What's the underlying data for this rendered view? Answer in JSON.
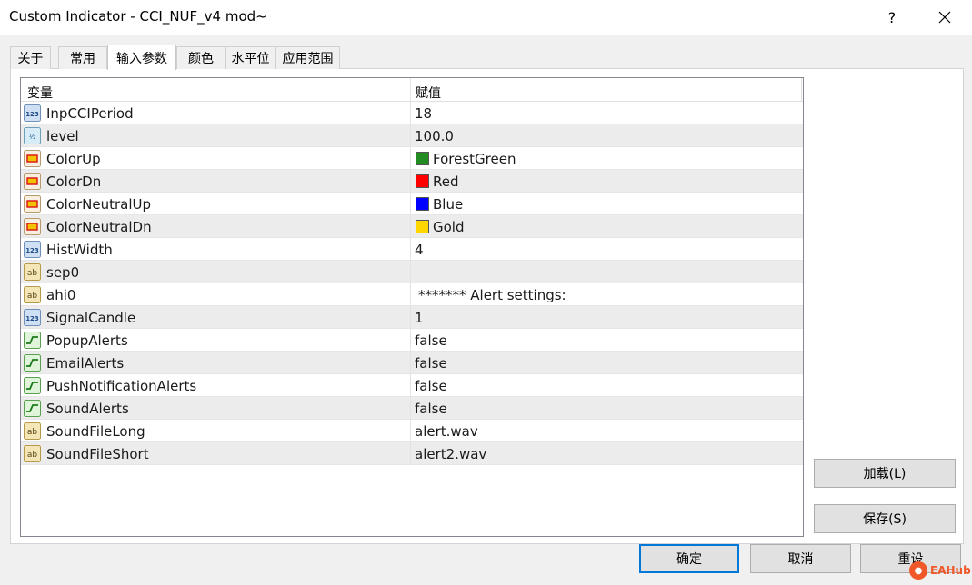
{
  "window": {
    "title": "Custom Indicator - CCI_NUF_v4 mod~",
    "help_label": "?"
  },
  "tabs": [
    {
      "label": "关于",
      "active": false
    },
    {
      "label": "常用",
      "active": false
    },
    {
      "label": "输入参数",
      "active": true
    },
    {
      "label": "颜色",
      "active": false
    },
    {
      "label": "水平位",
      "active": false
    },
    {
      "label": "应用范围",
      "active": false
    }
  ],
  "grid": {
    "col_variable": "变量",
    "col_value": "赋值",
    "rows": [
      {
        "icon": "integer-icon",
        "name": "InpCCIPeriod",
        "value": "18"
      },
      {
        "icon": "double-icon",
        "name": "level",
        "value": "100.0"
      },
      {
        "icon": "color-icon",
        "name": "ColorUp",
        "value": "ForestGreen",
        "swatch": "#228b22"
      },
      {
        "icon": "color-icon",
        "name": "ColorDn",
        "value": "Red",
        "swatch": "#ff0000"
      },
      {
        "icon": "color-icon",
        "name": "ColorNeutralUp",
        "value": "Blue",
        "swatch": "#0000ff"
      },
      {
        "icon": "color-icon",
        "name": "ColorNeutralDn",
        "value": "Gold",
        "swatch": "#ffd700"
      },
      {
        "icon": "integer-icon",
        "name": "HistWidth",
        "value": "4"
      },
      {
        "icon": "string-icon",
        "name": "sep0",
        "value": ""
      },
      {
        "icon": "string-icon",
        "name": "ahi0",
        "value": "******* Alert settings:"
      },
      {
        "icon": "integer-icon",
        "name": "SignalCandle",
        "value": "1"
      },
      {
        "icon": "bool-icon",
        "name": "PopupAlerts",
        "value": "false"
      },
      {
        "icon": "bool-icon",
        "name": "EmailAlerts",
        "value": "false"
      },
      {
        "icon": "bool-icon",
        "name": "PushNotificationAlerts",
        "value": "false"
      },
      {
        "icon": "bool-icon",
        "name": "SoundAlerts",
        "value": "false"
      },
      {
        "icon": "string-icon",
        "name": "SoundFileLong",
        "value": "alert.wav"
      },
      {
        "icon": "string-icon",
        "name": "SoundFileShort",
        "value": "alert2.wav"
      }
    ]
  },
  "buttons": {
    "load": "加载(L)",
    "save": "保存(S)",
    "ok": "确定",
    "cancel": "取消",
    "reset": "重设"
  },
  "watermark": {
    "text": "EAHub"
  }
}
